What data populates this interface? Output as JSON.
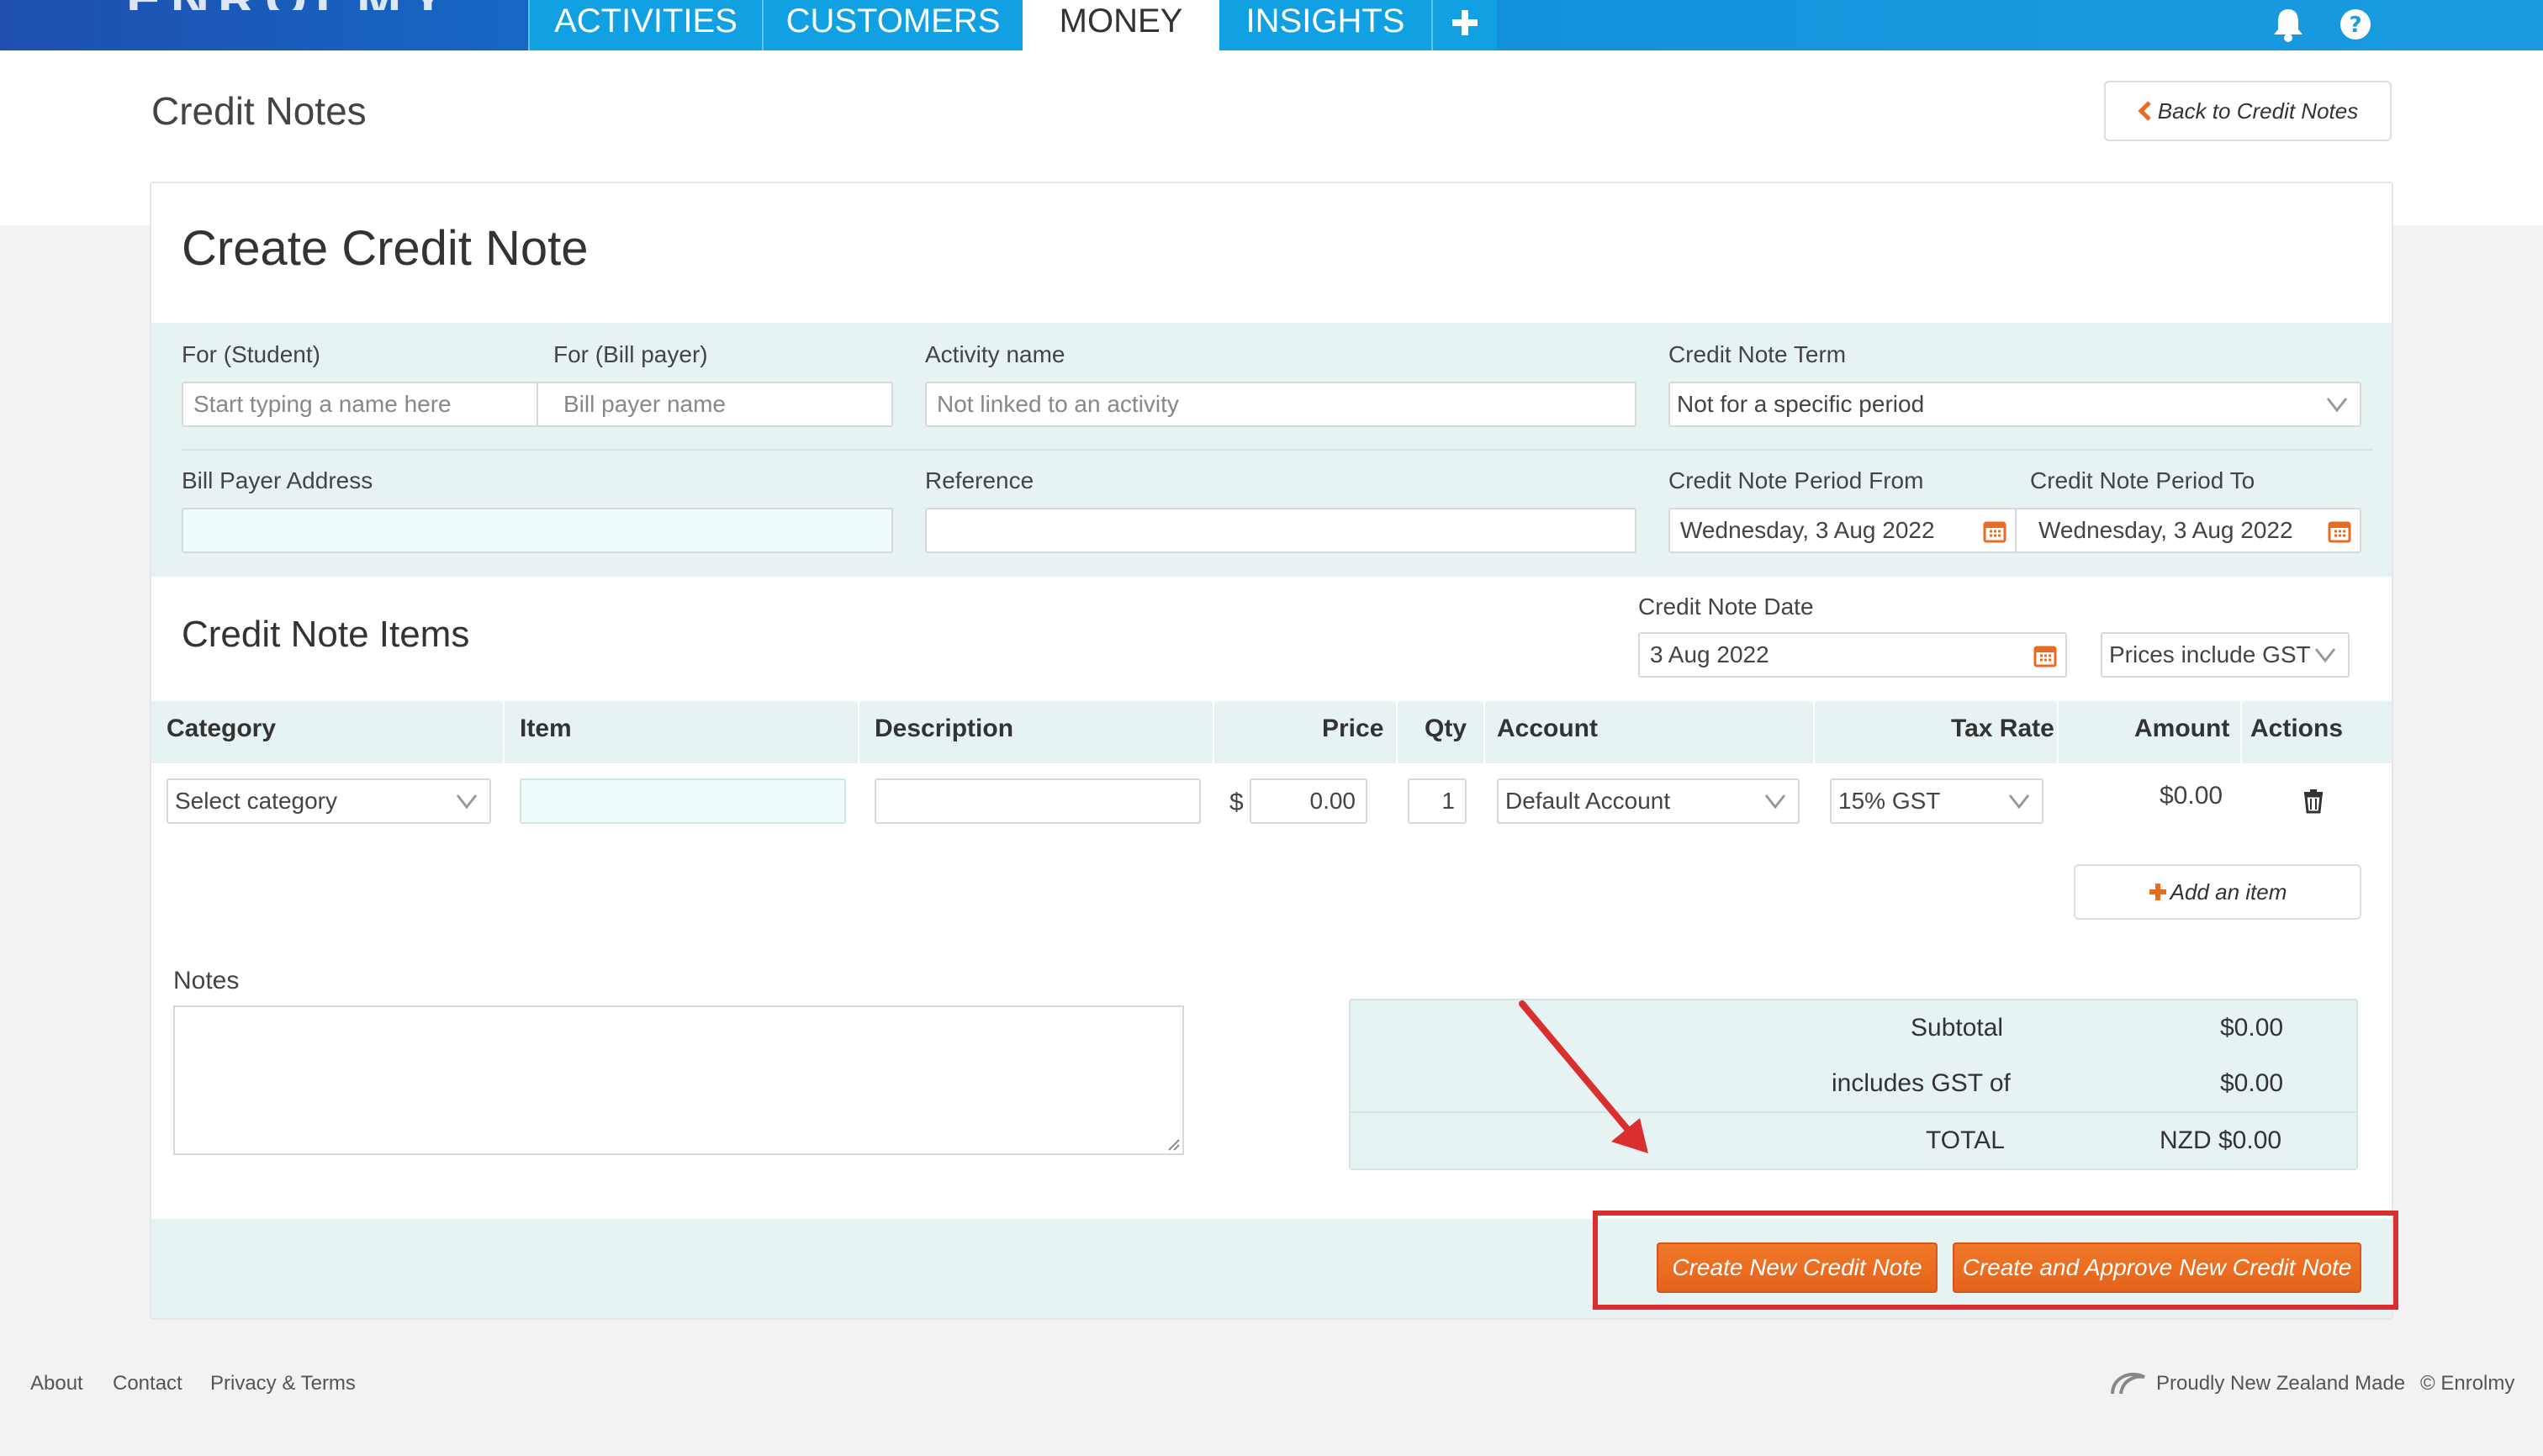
{
  "nav": {
    "logo": "ENROLMY",
    "tabs": [
      {
        "label": "ACTIVITIES"
      },
      {
        "label": "CUSTOMERS"
      },
      {
        "label": "MONEY"
      },
      {
        "label": "INSIGHTS"
      }
    ],
    "icons": [
      "plus-icon",
      "bell-icon",
      "help-icon"
    ],
    "colors": {
      "bar": "#1f4fae",
      "tab": "#11a0e2"
    }
  },
  "header": {
    "title": "Credit Notes",
    "back_button": "Back to Credit Notes"
  },
  "form": {
    "title": "Create Credit Note",
    "for_student": {
      "label": "For (Student)",
      "placeholder": "Start typing a name here"
    },
    "for_bill_payer": {
      "label": "For (Bill payer)",
      "placeholder": "Bill payer name"
    },
    "activity_name": {
      "label": "Activity name",
      "placeholder": "Not linked to an activity"
    },
    "credit_note_term": {
      "label": "Credit Note Term",
      "value": "Not for a specific period"
    },
    "bill_payer_address": {
      "label": "Bill Payer Address",
      "value": ""
    },
    "reference": {
      "label": "Reference",
      "value": ""
    },
    "period_from": {
      "label": "Credit Note Period From",
      "value": "Wednesday, 3 Aug 2022"
    },
    "period_to": {
      "label": "Credit Note Period To",
      "value": "Wednesday, 3 Aug 2022"
    }
  },
  "items": {
    "title": "Credit Note Items",
    "date": {
      "label": "Credit Note Date",
      "value": "3 Aug 2022"
    },
    "prices_mode": "Prices include GST",
    "columns": [
      "Category",
      "Item",
      "Description",
      "Price",
      "Qty",
      "Account",
      "Tax Rate",
      "Amount",
      "Actions"
    ],
    "row": {
      "category": "Select category",
      "item": "",
      "description": "",
      "currency": "$",
      "price": "0.00",
      "qty": "1",
      "account": "Default Account",
      "tax_rate": "15% GST",
      "amount": "$0.00"
    },
    "add_item": "Add an item"
  },
  "notes": {
    "label": "Notes",
    "value": ""
  },
  "totals": {
    "subtotal_label": "Subtotal",
    "subtotal": "$0.00",
    "gst_label": "includes GST of",
    "gst": "$0.00",
    "total_label": "TOTAL",
    "total": "NZD $0.00"
  },
  "actions": {
    "create": "Create New Credit Note",
    "create_approve": "Create and Approve New Credit Note",
    "accent": "#e96b1f"
  },
  "footer": {
    "links": [
      "About",
      "Contact",
      "Privacy & Terms"
    ],
    "made": "Proudly New Zealand Made",
    "copyright": "© Enrolmy"
  }
}
